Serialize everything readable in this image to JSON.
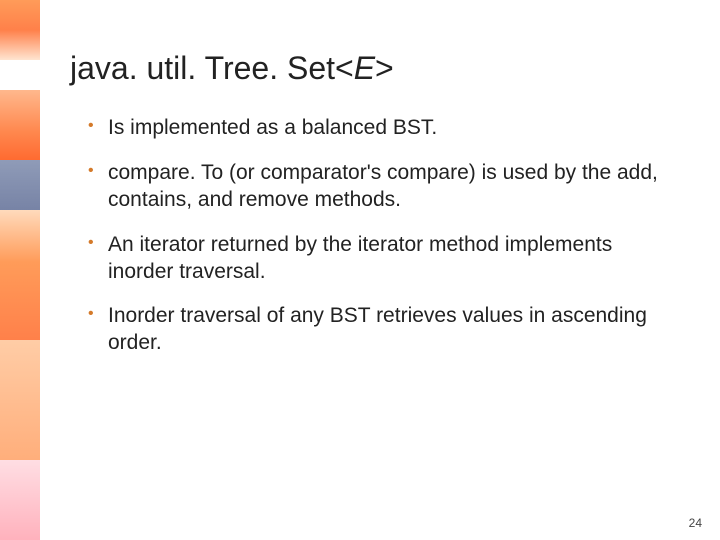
{
  "slide": {
    "title_prefix": "java. util. Tree. Set<",
    "title_generic": "E",
    "title_suffix": ">",
    "bullets": [
      "Is implemented as a balanced BST.",
      "compare. To (or comparator's compare) is used by the add, contains, and remove methods.",
      "An iterator returned by the iterator method implements inorder traversal.",
      "Inorder traversal of any BST retrieves values in ascending order."
    ],
    "page_number": "24"
  },
  "colors": {
    "bullet_accent": "#d47a2a"
  }
}
